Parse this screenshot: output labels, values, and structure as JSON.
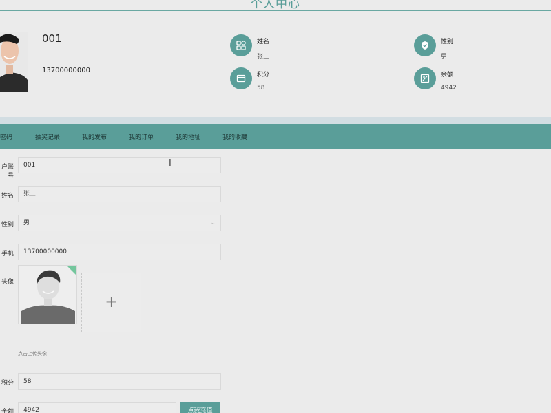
{
  "page": {
    "title": "个人中心"
  },
  "profile": {
    "account": "001",
    "phone": "13700000000"
  },
  "stats": [
    {
      "label": "姓名",
      "value": "张三",
      "icon": "grid-icon"
    },
    {
      "label": "性别",
      "value": "男",
      "icon": "shield-icon"
    },
    {
      "label": "积分",
      "value": "58",
      "icon": "card-icon"
    },
    {
      "label": "余额",
      "value": "4942",
      "icon": "wallet-icon"
    }
  ],
  "nav": {
    "items": [
      "密码",
      "抽奖记录",
      "我的发布",
      "我的订单",
      "我的地址",
      "我的收藏"
    ]
  },
  "form": {
    "account_label": "户账号",
    "account_value": "001",
    "name_label": "姓名",
    "name_value": "张三",
    "gender_label": "性别",
    "gender_value": "男",
    "phone_label": "手机",
    "phone_value": "13700000000",
    "avatar_label": "头像",
    "upload_plus": "+",
    "upload_hint": "点击上传头像",
    "points_label": "积分",
    "points_value": "58",
    "balance_label": "余额",
    "balance_value": "4942",
    "recharge_label": "点我充值"
  },
  "colors": {
    "accent": "#5a9e99",
    "band": "#d2dde2",
    "background": "#ebebeb"
  }
}
